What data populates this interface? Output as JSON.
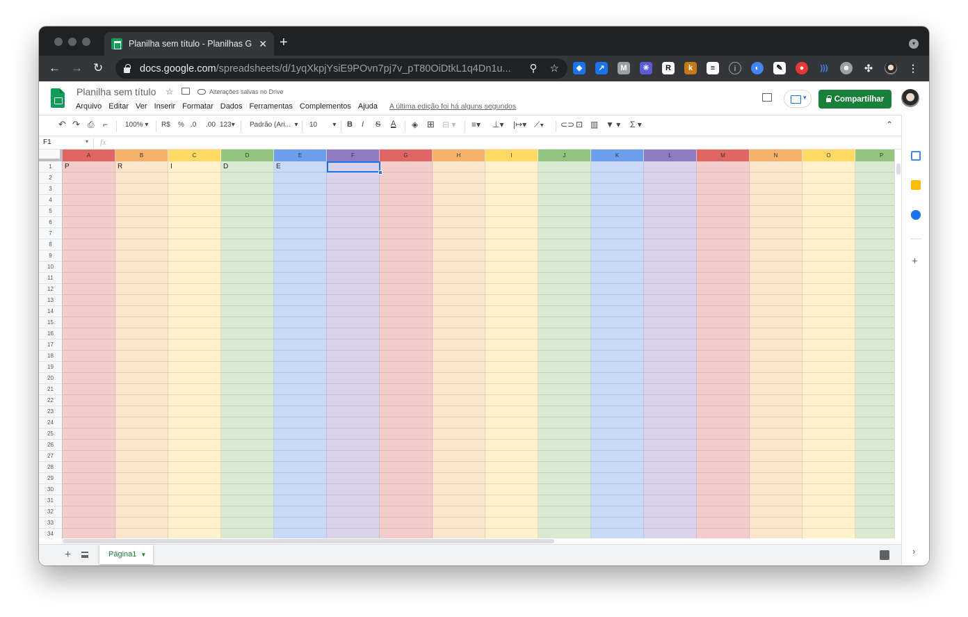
{
  "browser": {
    "tab_title": "Planilha sem título - Planilhas G",
    "url_host": "docs.google.com",
    "url_path": "/spreadsheets/d/1yqXkpjYsiE9POvn7pj7v_pT80OiDtkL1q4Dn1u..."
  },
  "doc": {
    "title": "Planilha sem título",
    "saved_status": "Alterações salvas no Drive",
    "last_edit": "A última edição foi há alguns segundos",
    "share_label": "Compartilhar"
  },
  "menu": [
    "Arquivo",
    "Editar",
    "Ver",
    "Inserir",
    "Formatar",
    "Dados",
    "Ferramentas",
    "Complementos",
    "Ajuda"
  ],
  "format_toolbar": {
    "zoom": "100%",
    "currency": "R$",
    "percent": "%",
    "decrease_decimal": ".0",
    "increase_decimal": ".00",
    "more_formats": "123",
    "font": "Padrão (Ari...",
    "font_size": "10"
  },
  "formula_bar": {
    "cell_ref": "F1",
    "fx": "fx"
  },
  "grid": {
    "columns": [
      {
        "label": "A",
        "header_color": "#e06666",
        "fill": "#f4cccc"
      },
      {
        "label": "B",
        "header_color": "#f6b26b",
        "fill": "#fce5cd"
      },
      {
        "label": "C",
        "header_color": "#ffd966",
        "fill": "#fff2cc"
      },
      {
        "label": "D",
        "header_color": "#93c47d",
        "fill": "#d9ead3"
      },
      {
        "label": "E",
        "header_color": "#6d9eeb",
        "fill": "#c9daf8"
      },
      {
        "label": "F",
        "header_color": "#8e7cc3",
        "fill": "#d9d2e9"
      },
      {
        "label": "G",
        "header_color": "#e06666",
        "fill": "#f4cccc"
      },
      {
        "label": "H",
        "header_color": "#f6b26b",
        "fill": "#fce5cd"
      },
      {
        "label": "I",
        "header_color": "#ffd966",
        "fill": "#fff2cc"
      },
      {
        "label": "J",
        "header_color": "#93c47d",
        "fill": "#d9ead3"
      },
      {
        "label": "K",
        "header_color": "#6d9eeb",
        "fill": "#c9daf8"
      },
      {
        "label": "L",
        "header_color": "#8e7cc3",
        "fill": "#d9d2e9"
      },
      {
        "label": "M",
        "header_color": "#e06666",
        "fill": "#f4cccc"
      },
      {
        "label": "N",
        "header_color": "#f6b26b",
        "fill": "#fce5cd"
      },
      {
        "label": "O",
        "header_color": "#ffd966",
        "fill": "#fff2cc"
      },
      {
        "label": "P",
        "header_color": "#93c47d",
        "fill": "#d9ead3"
      }
    ],
    "rows": [
      "1",
      "2",
      "3",
      "4",
      "5",
      "6",
      "7",
      "8",
      "9",
      "10",
      "11",
      "12",
      "13",
      "14",
      "15",
      "16",
      "17",
      "18",
      "19",
      "20",
      "21",
      "22",
      "23",
      "24",
      "25",
      "26",
      "27",
      "28",
      "29",
      "30",
      "31",
      "32",
      "33",
      "34"
    ],
    "row1_values": [
      "P",
      "R",
      "I",
      "D",
      "E",
      "",
      "",
      "",
      "",
      "",
      "",
      "",
      "",
      "",
      "",
      ""
    ],
    "selected_cell": "F1"
  },
  "sheets": {
    "active_tab": "Página1"
  },
  "colors": {
    "share_green": "#188038",
    "selection_blue": "#1a73e8",
    "chrome_dark": "#202124"
  }
}
